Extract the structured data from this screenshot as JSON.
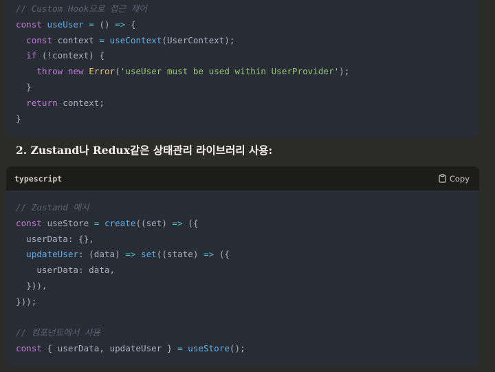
{
  "block1": {
    "lines": [
      [
        {
          "t": "// Custom Hook으로 접근 제어",
          "c": "c"
        }
      ],
      [
        {
          "t": "const",
          "c": "k"
        },
        {
          "t": " ",
          "c": "p"
        },
        {
          "t": "useUser",
          "c": "f"
        },
        {
          "t": " ",
          "c": "p"
        },
        {
          "t": "=",
          "c": "o"
        },
        {
          "t": " () ",
          "c": "p"
        },
        {
          "t": "=>",
          "c": "o"
        },
        {
          "t": " {",
          "c": "p"
        }
      ],
      [
        {
          "t": "  ",
          "c": "p"
        },
        {
          "t": "const",
          "c": "k"
        },
        {
          "t": " context ",
          "c": "p"
        },
        {
          "t": "=",
          "c": "o"
        },
        {
          "t": " ",
          "c": "p"
        },
        {
          "t": "useContext",
          "c": "f"
        },
        {
          "t": "(UserContext);",
          "c": "p"
        }
      ],
      [
        {
          "t": "  ",
          "c": "p"
        },
        {
          "t": "if",
          "c": "k"
        },
        {
          "t": " (!context) {",
          "c": "p"
        }
      ],
      [
        {
          "t": "    ",
          "c": "p"
        },
        {
          "t": "throw",
          "c": "k"
        },
        {
          "t": " ",
          "c": "p"
        },
        {
          "t": "new",
          "c": "k"
        },
        {
          "t": " ",
          "c": "p"
        },
        {
          "t": "Error",
          "c": "t"
        },
        {
          "t": "(",
          "c": "p"
        },
        {
          "t": "'useUser must be used within UserProvider'",
          "c": "s"
        },
        {
          "t": ");",
          "c": "p"
        }
      ],
      [
        {
          "t": "  }",
          "c": "p"
        }
      ],
      [
        {
          "t": "  ",
          "c": "p"
        },
        {
          "t": "return",
          "c": "k"
        },
        {
          "t": " context;",
          "c": "p"
        }
      ],
      [
        {
          "t": "}",
          "c": "p"
        }
      ]
    ]
  },
  "heading": "2. Zustand나 Redux같은 상태관리 라이브러리 사용:",
  "card": {
    "language": "typescript",
    "copy_label": "Copy",
    "copy_icon": "clipboard-icon"
  },
  "block2": {
    "lines": [
      [
        {
          "t": "// Zustand 예시",
          "c": "c"
        }
      ],
      [
        {
          "t": "const",
          "c": "k"
        },
        {
          "t": " useStore ",
          "c": "p"
        },
        {
          "t": "=",
          "c": "o"
        },
        {
          "t": " ",
          "c": "p"
        },
        {
          "t": "create",
          "c": "f"
        },
        {
          "t": "((set) ",
          "c": "p"
        },
        {
          "t": "=>",
          "c": "o"
        },
        {
          "t": " ({",
          "c": "p"
        }
      ],
      [
        {
          "t": "  userData: {},",
          "c": "p"
        }
      ],
      [
        {
          "t": "  ",
          "c": "p"
        },
        {
          "t": "updateUser",
          "c": "f"
        },
        {
          "t": ": (data) ",
          "c": "p"
        },
        {
          "t": "=>",
          "c": "o"
        },
        {
          "t": " ",
          "c": "p"
        },
        {
          "t": "set",
          "c": "f"
        },
        {
          "t": "((state) ",
          "c": "p"
        },
        {
          "t": "=>",
          "c": "o"
        },
        {
          "t": " ({",
          "c": "p"
        }
      ],
      [
        {
          "t": "    userData: data,",
          "c": "p"
        }
      ],
      [
        {
          "t": "  })),",
          "c": "p"
        }
      ],
      [
        {
          "t": "}));",
          "c": "p"
        }
      ],
      [
        {
          "t": "",
          "c": "p"
        }
      ],
      [
        {
          "t": "// 컴포넌트에서 사용",
          "c": "c"
        }
      ],
      [
        {
          "t": "const",
          "c": "k"
        },
        {
          "t": " { userData, updateUser } ",
          "c": "p"
        },
        {
          "t": "=",
          "c": "o"
        },
        {
          "t": " ",
          "c": "p"
        },
        {
          "t": "useStore",
          "c": "f"
        },
        {
          "t": "();",
          "c": "p"
        }
      ]
    ]
  }
}
